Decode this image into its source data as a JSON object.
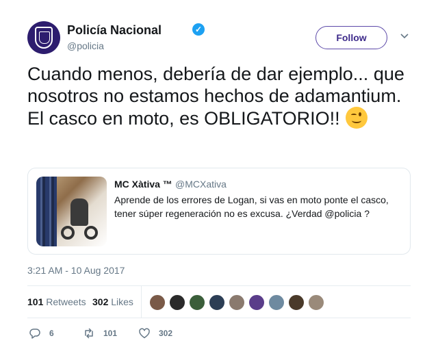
{
  "author": {
    "name": "Policía Nacional",
    "handle": "@policia",
    "verified_color": "#1da1f2",
    "avatar_color": "#2d1d6e"
  },
  "follow_button": {
    "label": "Follow"
  },
  "tweet": {
    "text": "Cuando menos, debería de dar ejemplo... que nosotros no estamos hechos de adamantium. El casco en moto, es OBLIGATORIO!!",
    "emoji": "winking-face-emoji"
  },
  "quoted_tweet": {
    "name": "MC Xàtiva ™",
    "handle": "@MCXativa",
    "text": "Aprende de los errores de Logan, si vas en moto ponte el casco, tener súper regeneración no es excusa. ¿Verdad @policia ?"
  },
  "timestamp": "3:21 AM - 10 Aug 2017",
  "stats": {
    "retweets_count": "101",
    "retweets_label": "Retweets",
    "likes_count": "302",
    "likes_label": "Likes"
  },
  "likers": [
    {
      "color": "#7a5a48"
    },
    {
      "color": "#2a2a2a"
    },
    {
      "color": "#3b5e3a"
    },
    {
      "color": "#2c3e55"
    },
    {
      "color": "#8a7a6e"
    },
    {
      "color": "#5a3d8a"
    },
    {
      "color": "#6e8aa0"
    },
    {
      "color": "#4a3a2a"
    },
    {
      "color": "#9a8a7a"
    }
  ],
  "actions": {
    "reply_count": "6",
    "retweet_count": "101",
    "like_count": "302"
  }
}
